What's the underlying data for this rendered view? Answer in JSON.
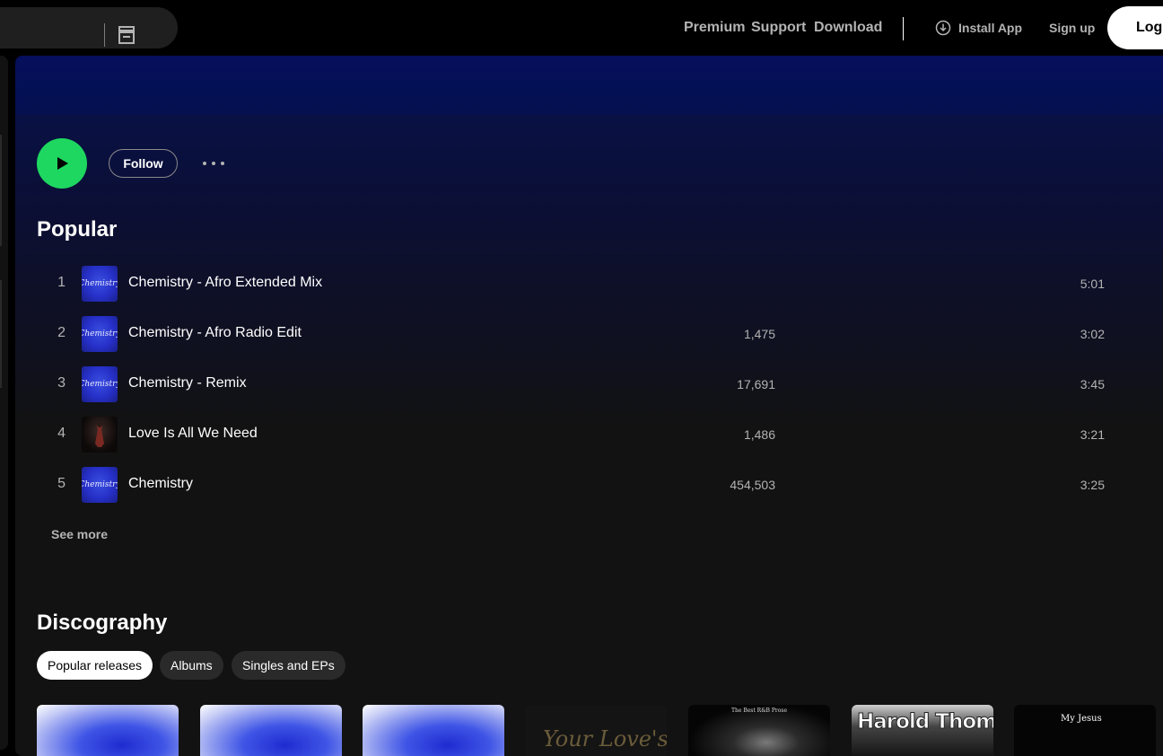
{
  "topbar": {
    "links": [
      "Premium",
      "Support",
      "Download"
    ],
    "install_label": "Install App",
    "signup_label": "Sign up",
    "login_label": "Log in"
  },
  "artist": {
    "follow_label": "Follow"
  },
  "popular": {
    "title": "Popular",
    "see_more": "See more",
    "tracks": [
      {
        "num": "1",
        "title": "Chemistry - Afro Extended Mix",
        "plays": "",
        "duration": "5:01",
        "art": "chemistry"
      },
      {
        "num": "2",
        "title": "Chemistry - Afro Radio Edit",
        "plays": "1,475",
        "duration": "3:02",
        "art": "chemistry"
      },
      {
        "num": "3",
        "title": "Chemistry - Remix",
        "plays": "17,691",
        "duration": "3:45",
        "art": "chemistry"
      },
      {
        "num": "4",
        "title": "Love Is All We Need",
        "plays": "1,486",
        "duration": "3:21",
        "art": "love"
      },
      {
        "num": "5",
        "title": "Chemistry",
        "plays": "454,503",
        "duration": "3:25",
        "art": "chemistry"
      }
    ]
  },
  "art_text": {
    "chemistry": "Chemistry"
  },
  "discography": {
    "title": "Discography",
    "filters": [
      "Popular releases",
      "Albums",
      "Singles and EPs"
    ],
    "active_filter": 0,
    "release_texts": {
      "r4": "Your Love's",
      "r5": "The Best R&B Prose",
      "r6": "Harold Thomas",
      "r7": "My Jesus"
    }
  },
  "colors": {
    "accent": "#1ed760",
    "background": "#121212",
    "header_gradient": "#050f5c",
    "muted_text": "#b3b3b3"
  }
}
